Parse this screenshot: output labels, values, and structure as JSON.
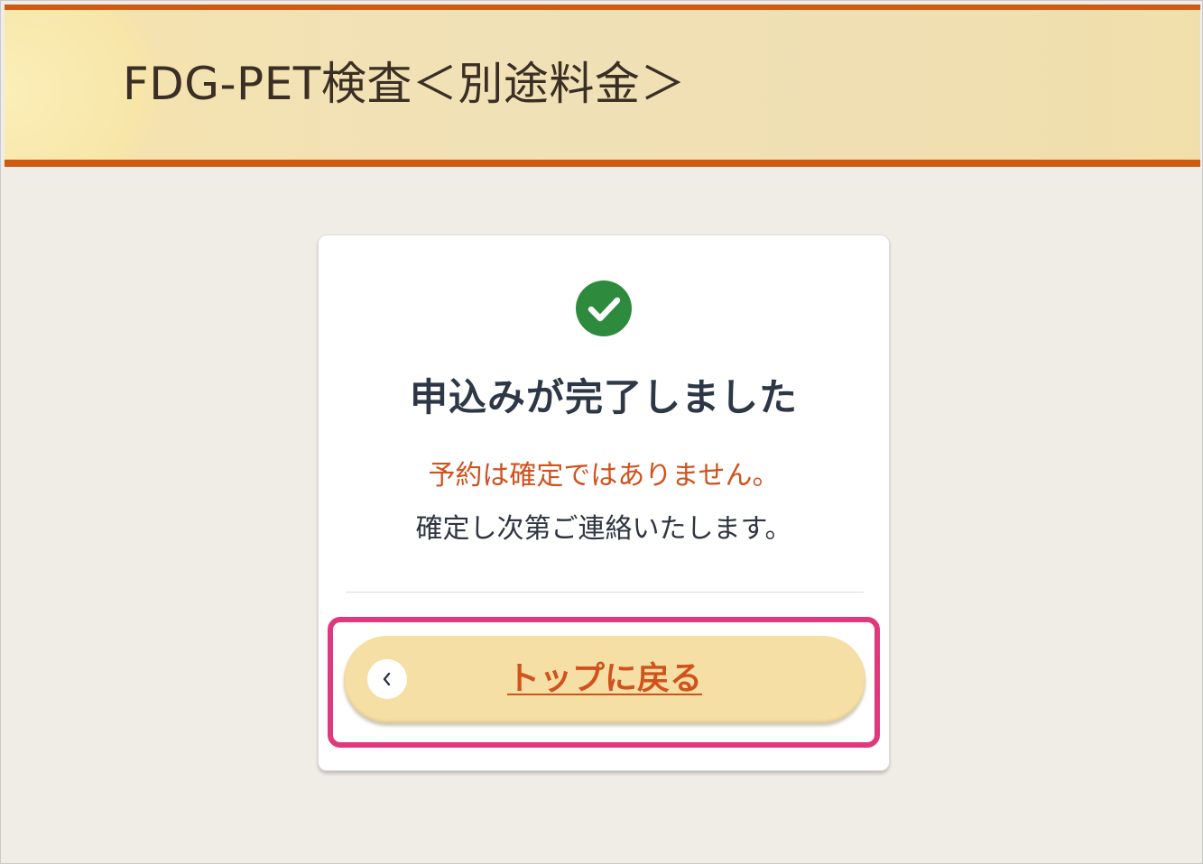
{
  "header": {
    "title": "FDG-PET検査＜別途料金＞"
  },
  "card": {
    "status_icon": "check-circle-icon",
    "heading": "申込みが完了しました",
    "warning": "予約は確定ではありません。",
    "info": "確定し次第ご連絡いたします。",
    "back_button": {
      "label": "トップに戻る",
      "icon": "chevron-left-icon"
    }
  },
  "colors": {
    "accent": "#cf5a12",
    "warning_text": "#d0521d",
    "success": "#2e8b3e",
    "button_bg": "#f6dfa5",
    "highlight": "#e0387d"
  }
}
